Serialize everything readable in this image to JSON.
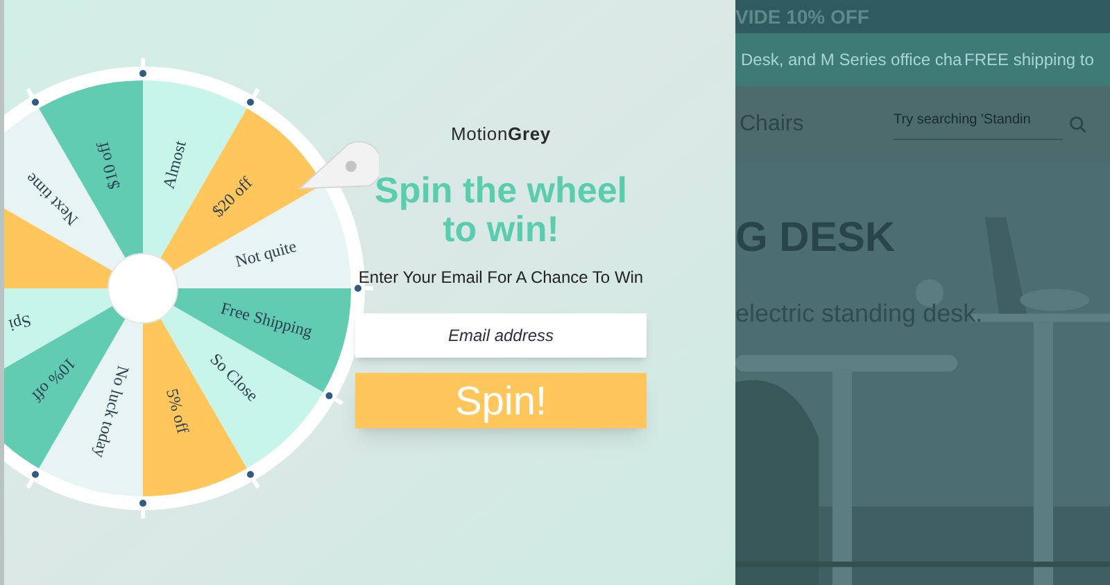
{
  "promo_bar": {
    "text": "VIDE 10% OFF"
  },
  "announcement": {
    "texts": [
      "Desk, and M Series office cha",
      "FREE shipping to"
    ]
  },
  "nav": {
    "link": "Chairs",
    "search": {
      "placeholder": "Try searching 'Standin"
    }
  },
  "hero": {
    "title": "G DESK",
    "subtitle": "electric standing desk."
  },
  "wheel": {
    "segments": [
      {
        "label": "Almost",
        "color": "#c8f5ea"
      },
      {
        "label": "$20 off",
        "color": "#fec65b"
      },
      {
        "label": "Not quite",
        "color": "#e7f4f3"
      },
      {
        "label": "Free Shipping",
        "color": "#62ccb3"
      },
      {
        "label": "So Close",
        "color": "#c8f5ea"
      },
      {
        "label": "5% off",
        "color": "#fec65b"
      },
      {
        "label": "No luck today",
        "color": "#e7f4f3"
      },
      {
        "label": "10% off",
        "color": "#62ccb3"
      },
      {
        "label": "Spi",
        "color": "#c8f5ea"
      },
      {
        "color": "#fec65b"
      },
      {
        "label": "Next time",
        "color": "#e7f4f3"
      },
      {
        "label": "$10 off",
        "color": "#62ccb3"
      }
    ]
  },
  "popup": {
    "logo": "Motion**Grey**",
    "title": "Spin the wheel to win!",
    "subtitle": "Enter Your Email For A Chance To Win",
    "email": {
      "placeholder": "Email address"
    },
    "button": "Spin!"
  }
}
